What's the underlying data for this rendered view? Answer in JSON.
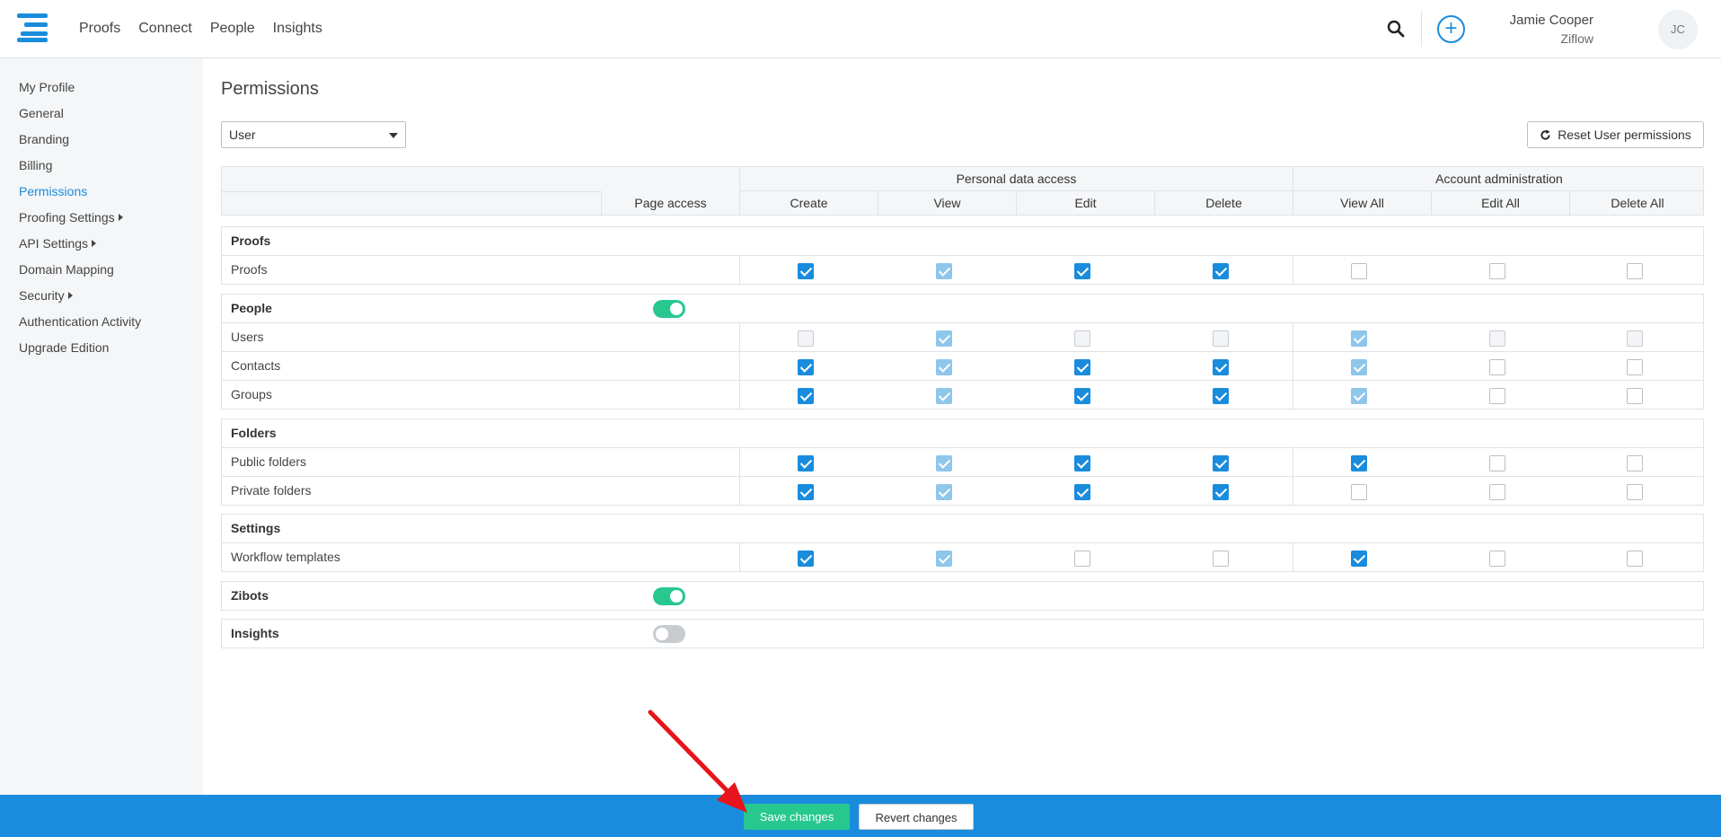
{
  "header": {
    "nav": [
      "Proofs",
      "Connect",
      "People",
      "Insights"
    ],
    "user_name": "Jamie Cooper",
    "user_org": "Ziflow",
    "avatar_initials": "JC",
    "add_symbol": "+"
  },
  "sidebar": {
    "items": [
      {
        "label": "My Profile",
        "active": false,
        "submenu": false
      },
      {
        "label": "General",
        "active": false,
        "submenu": false
      },
      {
        "label": "Branding",
        "active": false,
        "submenu": false
      },
      {
        "label": "Billing",
        "active": false,
        "submenu": false
      },
      {
        "label": "Permissions",
        "active": true,
        "submenu": false
      },
      {
        "label": "Proofing Settings",
        "active": false,
        "submenu": true
      },
      {
        "label": "API Settings",
        "active": false,
        "submenu": true
      },
      {
        "label": "Domain Mapping",
        "active": false,
        "submenu": false
      },
      {
        "label": "Security",
        "active": false,
        "submenu": true
      },
      {
        "label": "Authentication Activity",
        "active": false,
        "submenu": false
      },
      {
        "label": "Upgrade Edition",
        "active": false,
        "submenu": false
      }
    ]
  },
  "main": {
    "title": "Permissions",
    "role_select": {
      "value": "User"
    },
    "reset_button": "Reset User permissions",
    "table": {
      "groups": [
        "Personal data access",
        "Account administration"
      ],
      "columns": [
        "Page access",
        "Create",
        "View",
        "Edit",
        "Delete",
        "View All",
        "Edit All",
        "Delete All"
      ],
      "sections": [
        {
          "title": "Proofs",
          "toggle": null,
          "rows": [
            {
              "label": "Proofs",
              "cells": [
                "on",
                "light",
                "on",
                "on",
                "off",
                "off",
                "off"
              ]
            }
          ]
        },
        {
          "title": "People",
          "toggle": "on",
          "rows": [
            {
              "label": "Users",
              "cells": [
                "disabled",
                "light",
                "disabled",
                "disabled",
                "light",
                "disabled",
                "disabled"
              ]
            },
            {
              "label": "Contacts",
              "cells": [
                "on",
                "light",
                "on",
                "on",
                "light",
                "off",
                "off"
              ]
            },
            {
              "label": "Groups",
              "cells": [
                "on",
                "light",
                "on",
                "on",
                "light",
                "off",
                "off"
              ]
            }
          ]
        },
        {
          "title": "Folders",
          "toggle": null,
          "rows": [
            {
              "label": "Public folders",
              "cells": [
                "on",
                "light",
                "on",
                "on",
                "on",
                "off",
                "off"
              ]
            },
            {
              "label": "Private folders",
              "cells": [
                "on",
                "light",
                "on",
                "on",
                "off",
                "off",
                "off"
              ]
            }
          ]
        },
        {
          "title": "Settings",
          "toggle": null,
          "rows": [
            {
              "label": "Workflow templates",
              "cells": [
                "on",
                "light",
                "off",
                "off",
                "on",
                "off",
                "off"
              ]
            }
          ]
        },
        {
          "title": "Zibots",
          "toggle": "on",
          "rows": []
        },
        {
          "title": "Insights",
          "toggle": "off",
          "rows": []
        }
      ]
    }
  },
  "footer": {
    "save": "Save changes",
    "revert": "Revert changes"
  },
  "colors": {
    "primary": "#1a8cdd",
    "success": "#27c88f",
    "annotation": "#e8141b"
  }
}
